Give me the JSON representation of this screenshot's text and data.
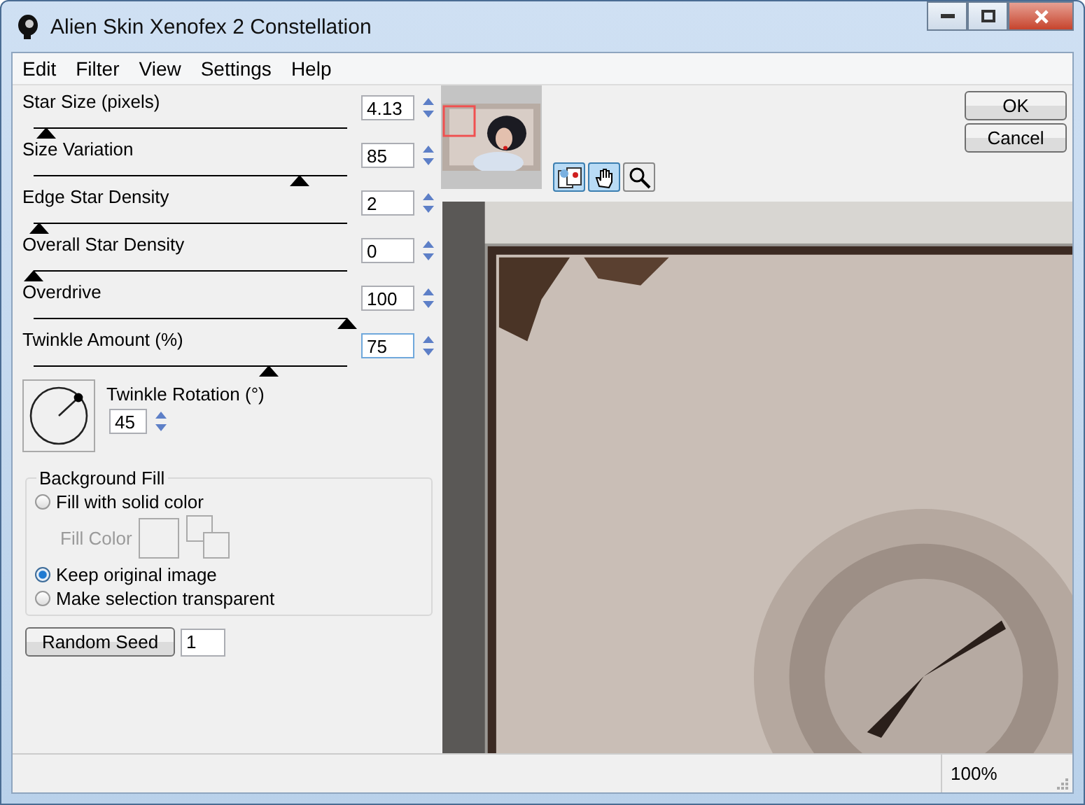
{
  "window": {
    "title": "Alien Skin Xenofex 2 Constellation"
  },
  "menu": [
    "Edit",
    "Filter",
    "View",
    "Settings",
    "Help"
  ],
  "sliders": [
    {
      "label": "Star Size (pixels)",
      "value": "4.13",
      "level": 0.04,
      "focused": false
    },
    {
      "label": "Size Variation",
      "value": "85",
      "level": 0.85,
      "focused": false
    },
    {
      "label": "Edge Star Density",
      "value": "2",
      "level": 0.02,
      "focused": false
    },
    {
      "label": "Overall Star Density",
      "value": "0",
      "level": 0,
      "focused": false
    },
    {
      "label": "Overdrive",
      "value": "100",
      "level": 1,
      "focused": false
    },
    {
      "label": "Twinkle Amount (%)",
      "value": "75",
      "level": 0.75,
      "focused": true
    }
  ],
  "rotation": {
    "label": "Twinkle Rotation (°)",
    "value": "45"
  },
  "background_fill": {
    "title": "Background Fill",
    "options": [
      {
        "label": "Fill with solid color",
        "selected": false
      },
      {
        "label": "Keep original image",
        "selected": true
      },
      {
        "label": "Make selection transparent",
        "selected": false
      }
    ],
    "fill_color": {
      "label": "Fill Color",
      "disabled": true
    }
  },
  "random_seed": {
    "button": "Random Seed",
    "value": "1"
  },
  "tools": [
    {
      "kind": "preview",
      "selected": true
    },
    {
      "kind": "hand",
      "selected": true
    },
    {
      "kind": "zoom",
      "selected": false
    }
  ],
  "buttons": [
    "OK",
    "Cancel"
  ],
  "status_bar": {
    "zoom": "100%"
  }
}
